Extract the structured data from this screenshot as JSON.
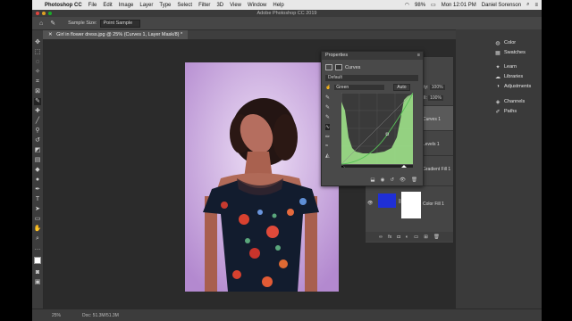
{
  "menubar": {
    "apple": "",
    "app_name": "Photoshop CC",
    "items": [
      "File",
      "Edit",
      "Image",
      "Layer",
      "Type",
      "Select",
      "Filter",
      "3D",
      "View",
      "Window",
      "Help"
    ],
    "battery": "98%",
    "clock": "Mon 12:01 PM",
    "user": "Daniel Sorenson"
  },
  "window": {
    "title": "Adobe Photoshop CC 2019"
  },
  "options_bar": {
    "sample_size_label": "Sample Size:",
    "sample_size_value": "Point Sample"
  },
  "document_tab": {
    "label": "Girl in flower dress.jpg @ 25% (Curves 1, Layer Mask/8) *"
  },
  "properties": {
    "title": "Properties",
    "adjustment": "Curves",
    "preset": "Default",
    "channel": "Green",
    "auto_label": "Auto"
  },
  "layers_panel": {
    "opacity_label": "ity:",
    "opacity_value": "100%",
    "fill_label": "ill:",
    "fill_value": "100%",
    "rows": [
      {
        "name": "Curves 1"
      },
      {
        "name": "Levels 1"
      },
      {
        "name": "Gradient Fill 1"
      },
      {
        "name": "Color Fill 1"
      }
    ]
  },
  "right_dock": {
    "groups": [
      [
        "Color",
        "Swatches"
      ],
      [
        "Learn",
        "Libraries",
        "Adjustments"
      ],
      [
        "Channels",
        "Paths"
      ]
    ]
  },
  "status_bar": {
    "zoom": "25%",
    "doc_info": "Doc: 51.3M/51.3M"
  },
  "colors": {
    "color_fill_swatch": "#1f2fd6",
    "curve_histogram": "#9fe28a"
  }
}
